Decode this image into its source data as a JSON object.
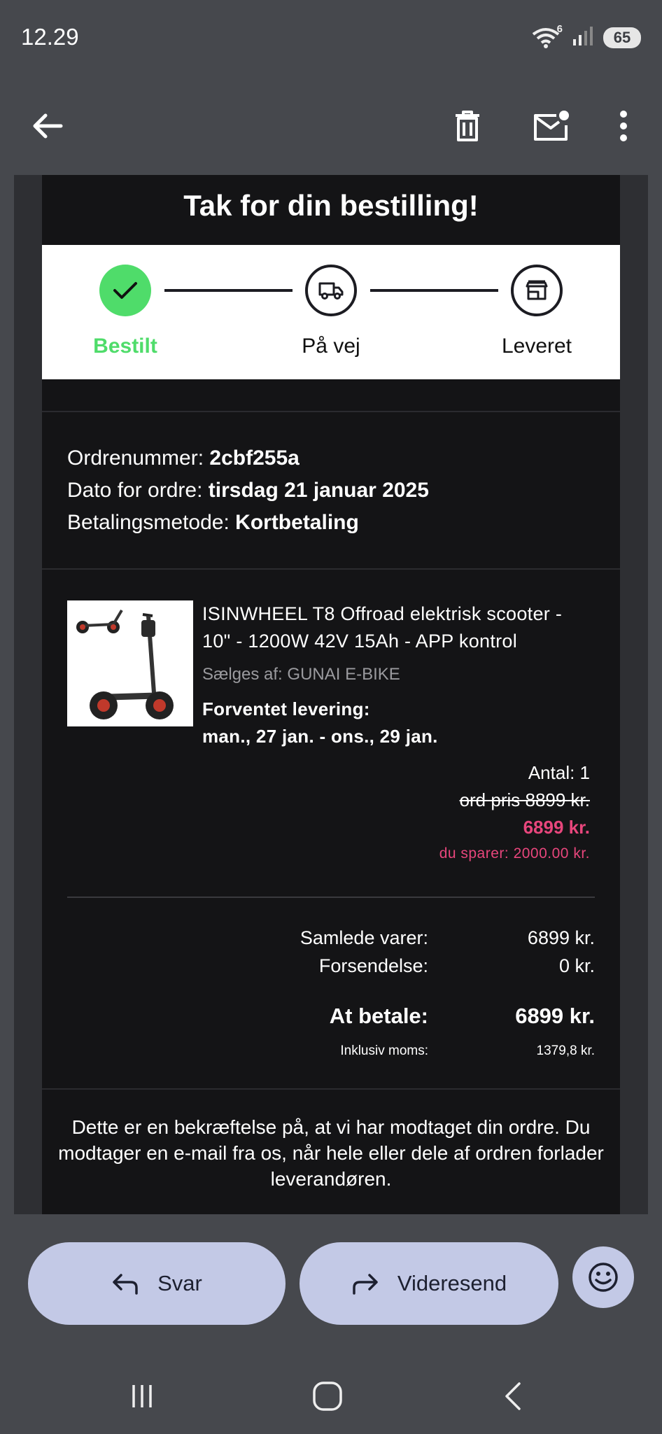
{
  "status_bar": {
    "time": "12.29",
    "wifi_badge": "6",
    "battery": "65"
  },
  "toolbar": {
    "back_icon": "arrow-left-icon",
    "delete_icon": "trash-icon",
    "mark_unread_icon": "mail-unread-icon",
    "more_icon": "more-vert-icon"
  },
  "email": {
    "title": "Tak for din bestilling!",
    "progress": {
      "steps": [
        {
          "label": "Bestilt",
          "state": "done",
          "icon": "check-icon"
        },
        {
          "label": "På vej",
          "state": "pending",
          "icon": "truck-icon"
        },
        {
          "label": "Leveret",
          "state": "pending",
          "icon": "store-icon"
        }
      ],
      "done_color": "#4fdc6a"
    },
    "order": {
      "number_label": "Ordrenummer:",
      "number_value": "2cbf255a",
      "date_label": "Dato for ordre:",
      "date_value": "tirsdag 21 januar 2025",
      "payment_label": "Betalingsmetode:",
      "payment_value": "Kortbetaling"
    },
    "product": {
      "title": "ISINWHEEL T8 Offroad elektrisk scooter - 10\" - 1200W 42V 15Ah - APP kontrol",
      "seller": "Sælges af: GUNAI E-BIKE",
      "delivery_label": "Forventet levering:",
      "delivery_value": "man., 27 jan. - ons., 29 jan.",
      "quantity": "Antal: 1",
      "old_price": "ord pris 8899 kr.",
      "new_price": "6899 kr.",
      "saving": "du sparer: 2000.00 kr.",
      "image_icon": "scooter-image"
    },
    "totals": {
      "items_label": "Samlede varer:",
      "items_value": "6899 kr.",
      "shipping_label": "Forsendelse:",
      "shipping_value": "0 kr.",
      "pay_label": "At betale:",
      "pay_value": "6899 kr.",
      "vat_label": "Inklusiv moms:",
      "vat_value": "1379,8 kr."
    },
    "confirmation": "Dette er en bekræftelse på, at vi har modtaget din ordre. Du modtager en e-mail fra os, når hele eller dele af ordren forlader leverandøren.",
    "accent_color": "#e8467c"
  },
  "actions": {
    "reply_label": "Svar",
    "forward_label": "Videresend",
    "emoji_icon": "emoji-smile-icon"
  },
  "navbar": {
    "recents_icon": "recents-icon",
    "home_icon": "home-icon",
    "back_icon": "nav-back-icon"
  }
}
